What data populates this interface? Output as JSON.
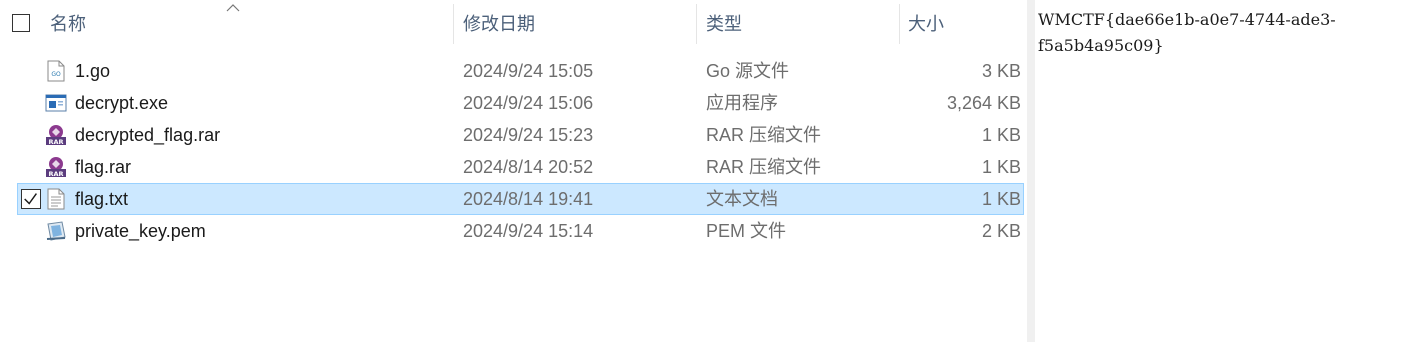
{
  "header": {
    "name_label": "名称",
    "date_label": "修改日期",
    "type_label": "类型",
    "size_label": "大小"
  },
  "files": [
    {
      "name": "1.go",
      "date": "2024/9/24 15:05",
      "type": "Go 源文件",
      "size": "3 KB",
      "icon": "go-file-icon",
      "selected": false
    },
    {
      "name": "decrypt.exe",
      "date": "2024/9/24 15:06",
      "type": "应用程序",
      "size": "3,264 KB",
      "icon": "exe-file-icon",
      "selected": false
    },
    {
      "name": "decrypted_flag.rar",
      "date": "2024/9/24 15:23",
      "type": "RAR 压缩文件",
      "size": "1 KB",
      "icon": "rar-file-icon",
      "selected": false
    },
    {
      "name": "flag.rar",
      "date": "2024/8/14 20:52",
      "type": "RAR 压缩文件",
      "size": "1 KB",
      "icon": "rar-file-icon",
      "selected": false
    },
    {
      "name": "flag.txt",
      "date": "2024/8/14 19:41",
      "type": "文本文档",
      "size": "1 KB",
      "icon": "text-file-icon",
      "selected": true
    },
    {
      "name": "private_key.pem",
      "date": "2024/9/24 15:14",
      "type": "PEM 文件",
      "size": "2 KB",
      "icon": "pem-file-icon",
      "selected": false
    }
  ],
  "preview": {
    "content": "WMCTF{dae66e1b-a0e7-4744-ade3-f5a5b4a95c09}"
  },
  "colors": {
    "selection_bg": "#cce8ff",
    "selection_border": "#99d1ff",
    "header_text": "#4c607a",
    "secondary_text": "#6d6d6d"
  }
}
